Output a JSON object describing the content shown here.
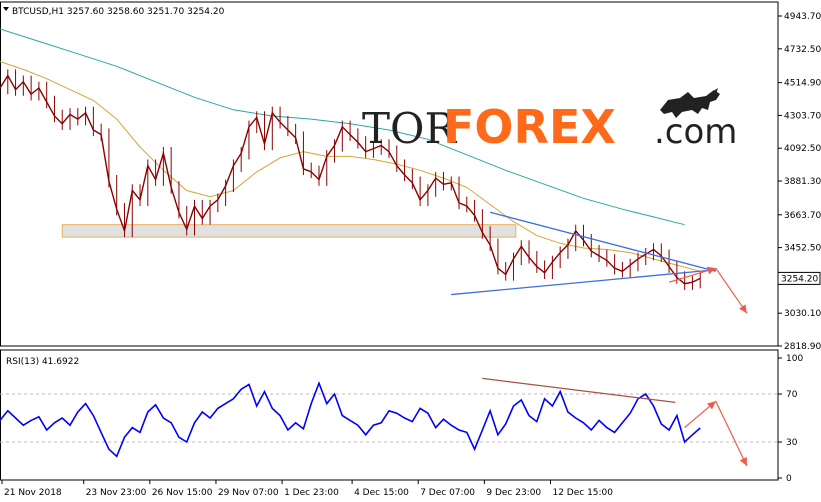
{
  "header": {
    "symbol_line": "BTCUSD,H1  3257.60 3258.60 3251.70 3254.20"
  },
  "watermark": {
    "tor": "TOR",
    "forex": "FOREX",
    "com": ".com",
    "bull_icon": "bull-icon"
  },
  "colors": {
    "price_line": "#8b0000",
    "ma_fast": "#d4a53a",
    "ma_slow": "#2aa6a6",
    "rsi_line": "#0000ff",
    "trend_line": "#3b6fe0",
    "forecast_arrow": "#f05a4a",
    "rsi_trend": "#a5524a",
    "zone_fill": "#dcdcdc",
    "zone_border": "#e8a040",
    "price_tag_bg": "#ffffff"
  },
  "chart_data": [
    {
      "type": "line",
      "title": "BTCUSD,H1",
      "ohlc_readout": {
        "open": 3257.6,
        "high": 3258.6,
        "low": 3251.7,
        "close": 3254.2
      },
      "ylim": [
        2818.9,
        4943.7
      ],
      "y_ticks": [
        "4943.70",
        "4732.50",
        "4514.90",
        "4303.70",
        "4092.50",
        "3881.30",
        "3663.70",
        "3452.50",
        "3030.10",
        "2818.90"
      ],
      "current_price_label": "3254.20",
      "x_tick_labels": [
        "21 Nov 2018",
        "23 Nov 23:00",
        "26 Nov 15:00",
        "29 Nov 07:00",
        "1 Dec 23:00",
        "4 Dec 15:00",
        "7 Dec 07:00",
        "9 Dec 23:00",
        "12 Dec 15:00"
      ],
      "x_index_range": [
        0,
        100
      ],
      "series": [
        {
          "values": [
            [
              0,
              4480
            ],
            [
              1,
              4560
            ],
            [
              2,
              4470
            ],
            [
              3,
              4520
            ],
            [
              4,
              4440
            ],
            [
              5,
              4480
            ],
            [
              6,
              4390
            ],
            [
              7,
              4300
            ],
            [
              8,
              4250
            ],
            [
              9,
              4310
            ],
            [
              10,
              4280
            ],
            [
              11,
              4320
            ],
            [
              12,
              4210
            ],
            [
              13,
              4180
            ],
            [
              14,
              3880
            ],
            [
              15,
              3700
            ],
            [
              16,
              3560
            ],
            [
              17,
              3820
            ],
            [
              18,
              3760
            ],
            [
              19,
              3980
            ],
            [
              20,
              3890
            ],
            [
              21,
              4060
            ],
            [
              22,
              3840
            ],
            [
              23,
              3680
            ],
            [
              24,
              3570
            ],
            [
              25,
              3720
            ],
            [
              26,
              3640
            ],
            [
              27,
              3720
            ],
            [
              28,
              3760
            ],
            [
              29,
              3850
            ],
            [
              30,
              3980
            ],
            [
              31,
              4060
            ],
            [
              32,
              4230
            ],
            [
              33,
              4290
            ],
            [
              34,
              4120
            ],
            [
              35,
              4320
            ],
            [
              36,
              4260
            ],
            [
              37,
              4210
            ],
            [
              38,
              4160
            ],
            [
              39,
              3960
            ],
            [
              40,
              3940
            ],
            [
              41,
              3890
            ],
            [
              42,
              4040
            ],
            [
              43,
              4110
            ],
            [
              44,
              4230
            ],
            [
              45,
              4180
            ],
            [
              46,
              4130
            ],
            [
              47,
              4070
            ],
            [
              48,
              4090
            ],
            [
              49,
              4110
            ],
            [
              50,
              4070
            ],
            [
              51,
              3980
            ],
            [
              52,
              3920
            ],
            [
              53,
              3870
            ],
            [
              54,
              3760
            ],
            [
              55,
              3820
            ],
            [
              56,
              3900
            ],
            [
              57,
              3860
            ],
            [
              58,
              3870
            ],
            [
              59,
              3740
            ],
            [
              60,
              3720
            ],
            [
              61,
              3660
            ],
            [
              62,
              3550
            ],
            [
              63,
              3470
            ],
            [
              64,
              3320
            ],
            [
              65,
              3280
            ],
            [
              66,
              3380
            ],
            [
              67,
              3460
            ],
            [
              68,
              3390
            ],
            [
              69,
              3330
            ],
            [
              70,
              3290
            ],
            [
              71,
              3360
            ],
            [
              72,
              3420
            ],
            [
              73,
              3470
            ],
            [
              74,
              3560
            ],
            [
              75,
              3500
            ],
            [
              76,
              3430
            ],
            [
              77,
              3400
            ],
            [
              78,
              3370
            ],
            [
              79,
              3320
            ],
            [
              80,
              3300
            ],
            [
              81,
              3340
            ],
            [
              82,
              3380
            ],
            [
              83,
              3410
            ],
            [
              84,
              3440
            ],
            [
              85,
              3400
            ],
            [
              86,
              3330
            ],
            [
              87,
              3260
            ],
            [
              88,
              3220
            ],
            [
              89,
              3230
            ],
            [
              90,
              3254.2
            ]
          ]
        },
        {
          "values": [
            [
              0,
              4650
            ],
            [
              3,
              4600
            ],
            [
              6,
              4540
            ],
            [
              9,
              4470
            ],
            [
              12,
              4400
            ],
            [
              15,
              4280
            ],
            [
              18,
              4100
            ],
            [
              21,
              3950
            ],
            [
              24,
              3820
            ],
            [
              27,
              3780
            ],
            [
              30,
              3820
            ],
            [
              33,
              3940
            ],
            [
              36,
              4030
            ],
            [
              39,
              4070
            ],
            [
              42,
              4040
            ],
            [
              45,
              4040
            ],
            [
              48,
              4020
            ],
            [
              51,
              3990
            ],
            [
              54,
              3950
            ],
            [
              57,
              3900
            ],
            [
              60,
              3840
            ],
            [
              63,
              3730
            ],
            [
              66,
              3620
            ],
            [
              69,
              3530
            ],
            [
              72,
              3480
            ],
            [
              75,
              3450
            ],
            [
              78,
              3440
            ],
            [
              81,
              3420
            ],
            [
              84,
              3380
            ],
            [
              87,
              3340
            ],
            [
              90,
              3300
            ]
          ]
        },
        {
          "values": [
            [
              0,
              4860
            ],
            [
              5,
              4780
            ],
            [
              10,
              4700
            ],
            [
              15,
              4620
            ],
            [
              20,
              4520
            ],
            [
              25,
              4420
            ],
            [
              30,
              4340
            ],
            [
              35,
              4300
            ],
            [
              40,
              4280
            ],
            [
              45,
              4250
            ],
            [
              50,
              4210
            ],
            [
              55,
              4150
            ],
            [
              60,
              4050
            ],
            [
              65,
              3950
            ],
            [
              70,
              3860
            ],
            [
              75,
              3770
            ],
            [
              80,
              3700
            ],
            [
              84,
              3650
            ],
            [
              88,
              3600
            ]
          ]
        }
      ],
      "support_zone": {
        "from": 3520,
        "to": 3600,
        "x_from": 8,
        "x_to": 100
      },
      "trend_lines": [
        {
          "points": [
            [
              63,
              3680
            ],
            [
              92,
              3300
            ]
          ]
        },
        {
          "points": [
            [
              58,
              3150
            ],
            [
              92,
              3310
            ]
          ]
        }
      ],
      "forecast_arrows": [
        {
          "points": [
            [
              86,
              3230
            ],
            [
              92,
              3320
            ]
          ]
        },
        {
          "points": [
            [
              92,
              3320
            ],
            [
              96,
              3030
            ]
          ]
        }
      ]
    },
    {
      "type": "line",
      "title": "RSI(13) 41.6922",
      "ylim": [
        0,
        100
      ],
      "y_ticks": [
        "100",
        "70",
        "30",
        "0"
      ],
      "levels": [
        70,
        30
      ],
      "series": [
        {
          "values": [
            [
              0,
              48
            ],
            [
              1,
              56
            ],
            [
              2,
              50
            ],
            [
              3,
              44
            ],
            [
              4,
              48
            ],
            [
              5,
              51
            ],
            [
              6,
              40
            ],
            [
              7,
              46
            ],
            [
              8,
              50
            ],
            [
              9,
              44
            ],
            [
              10,
              55
            ],
            [
              11,
              62
            ],
            [
              12,
              52
            ],
            [
              13,
              38
            ],
            [
              14,
              24
            ],
            [
              15,
              18
            ],
            [
              16,
              34
            ],
            [
              17,
              42
            ],
            [
              18,
              38
            ],
            [
              19,
              55
            ],
            [
              20,
              61
            ],
            [
              21,
              50
            ],
            [
              22,
              46
            ],
            [
              23,
              34
            ],
            [
              24,
              30
            ],
            [
              25,
              46
            ],
            [
              26,
              55
            ],
            [
              27,
              50
            ],
            [
              28,
              58
            ],
            [
              29,
              62
            ],
            [
              30,
              66
            ],
            [
              31,
              74
            ],
            [
              32,
              78
            ],
            [
              33,
              60
            ],
            [
              34,
              72
            ],
            [
              35,
              58
            ],
            [
              36,
              52
            ],
            [
              37,
              40
            ],
            [
              38,
              46
            ],
            [
              39,
              41
            ],
            [
              40,
              62
            ],
            [
              41,
              79
            ],
            [
              42,
              62
            ],
            [
              43,
              70
            ],
            [
              44,
              52
            ],
            [
              45,
              48
            ],
            [
              46,
              44
            ],
            [
              47,
              36
            ],
            [
              48,
              44
            ],
            [
              49,
              46
            ],
            [
              50,
              56
            ],
            [
              51,
              54
            ],
            [
              52,
              50
            ],
            [
              53,
              47
            ],
            [
              54,
              58
            ],
            [
              55,
              54
            ],
            [
              56,
              42
            ],
            [
              57,
              49
            ],
            [
              58,
              44
            ],
            [
              59,
              40
            ],
            [
              60,
              38
            ],
            [
              61,
              24
            ],
            [
              62,
              40
            ],
            [
              63,
              56
            ],
            [
              64,
              36
            ],
            [
              65,
              45
            ],
            [
              66,
              60
            ],
            [
              67,
              65
            ],
            [
              68,
              52
            ],
            [
              69,
              47
            ],
            [
              70,
              66
            ],
            [
              71,
              60
            ],
            [
              72,
              72
            ],
            [
              73,
              55
            ],
            [
              74,
              50
            ],
            [
              75,
              46
            ],
            [
              76,
              40
            ],
            [
              77,
              48
            ],
            [
              78,
              42
            ],
            [
              79,
              38
            ],
            [
              80,
              46
            ],
            [
              81,
              54
            ],
            [
              82,
              66
            ],
            [
              83,
              70
            ],
            [
              84,
              60
            ],
            [
              85,
              45
            ],
            [
              86,
              40
            ],
            [
              87,
              52
            ],
            [
              88,
              30
            ],
            [
              89,
              36
            ],
            [
              90,
              41.69
            ]
          ]
        }
      ],
      "trend_lines": [
        {
          "points": [
            [
              62,
              83
            ],
            [
              100,
              63
            ]
          ]
        }
      ],
      "forecast_arrows": [
        {
          "points": [
            [
              88,
              42
            ],
            [
              92,
              64
            ]
          ]
        },
        {
          "points": [
            [
              92,
              64
            ],
            [
              96,
              10
            ]
          ]
        }
      ]
    }
  ]
}
